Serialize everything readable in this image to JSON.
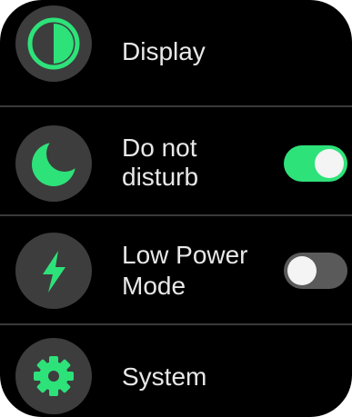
{
  "settings": {
    "items": [
      {
        "label": "Display",
        "icon": "contrast-icon"
      },
      {
        "label": "Do not disturb",
        "label_line1": "Do not",
        "label_line2": "disturb",
        "icon": "moon-icon",
        "toggle_on": true
      },
      {
        "label": "Low Power Mode",
        "label_line1": "Low Power",
        "label_line2": "Mode",
        "icon": "lightning-bolt-icon",
        "toggle_on": false
      },
      {
        "label": "System",
        "icon": "gear-icon"
      }
    ]
  },
  "colors": {
    "accent": "#2ee27a",
    "icon_bg": "#3d3d3d",
    "toggle_off": "#5a5a5a",
    "background": "#000000",
    "text": "#e8e8e8"
  }
}
